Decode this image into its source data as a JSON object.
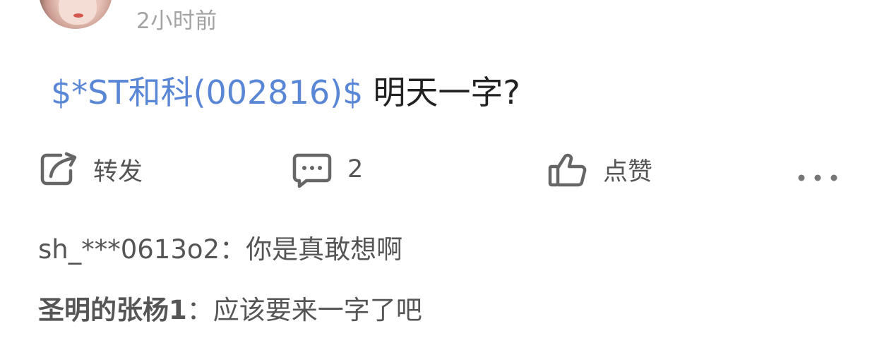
{
  "header": {
    "time": "2小时前"
  },
  "post": {
    "stock_tag": "$*ST和科(002816)$",
    "text": "明天一字?"
  },
  "actions": {
    "forward_label": "转发",
    "comment_count": "2",
    "like_label": "点赞"
  },
  "comments": [
    {
      "user": "sh_***0613o2",
      "separator": "：",
      "text": "你是真敢想啊"
    },
    {
      "user": "圣明的张杨1",
      "separator": "：",
      "text": "应该要来一字了吧"
    }
  ],
  "colors": {
    "stock_link": "#5a86d6",
    "text": "#222222",
    "muted": "#a3a3a3",
    "icon": "#666666"
  }
}
